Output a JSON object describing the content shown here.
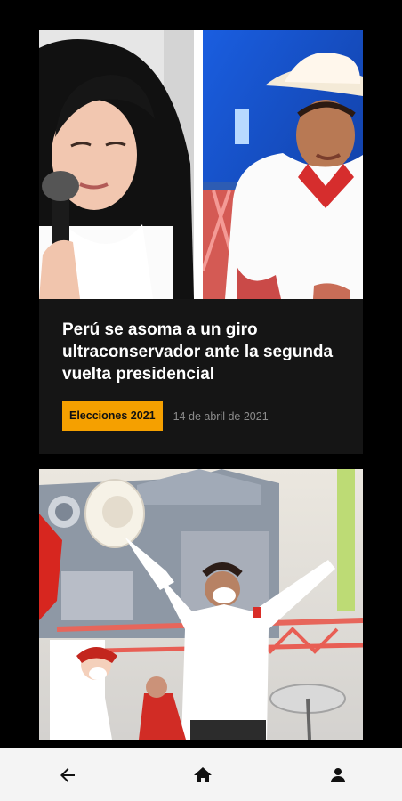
{
  "articles": [
    {
      "title": "Perú se asoma a un giro ultraconservador ante la segunda vuelta presidencial",
      "tag": "Elecciones 2021",
      "date": "14 de abril de 2021",
      "images": [
        "keiko-fujimori-photo",
        "pedro-castillo-photo"
      ]
    },
    {
      "image": "rally-photo"
    }
  ],
  "nav": {
    "icons": [
      "arrow-left-icon",
      "home-icon",
      "user-icon"
    ]
  },
  "colors": {
    "tag_bg": "#f5a000",
    "card_bg": "#151515",
    "nav_bg": "#f4f4f4"
  }
}
